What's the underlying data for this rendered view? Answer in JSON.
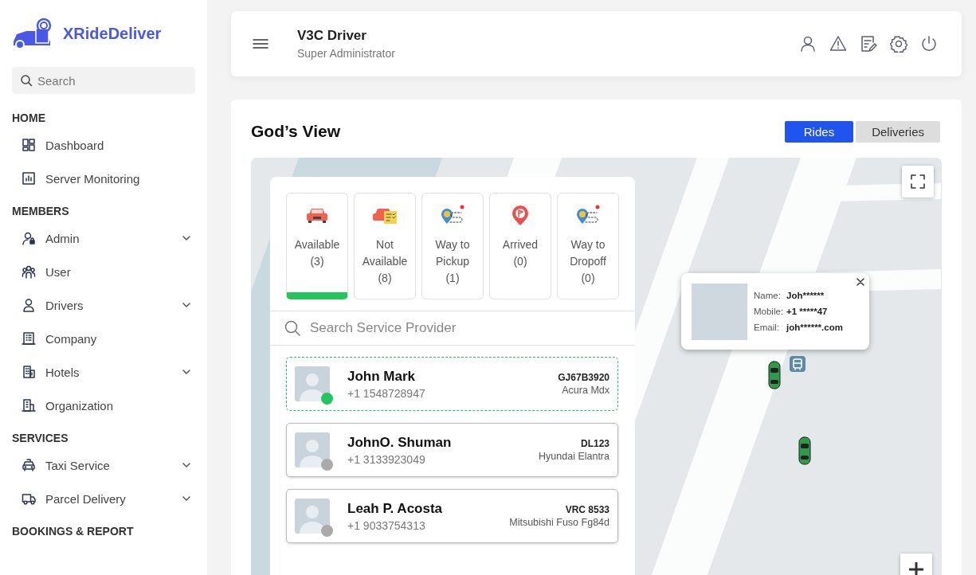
{
  "brand": {
    "name": "XRideDeliver"
  },
  "sidebar": {
    "search": {
      "placeholder": "Search"
    },
    "sections": [
      {
        "heading": "HOME",
        "items": [
          {
            "label": "Dashboard",
            "expandable": false
          },
          {
            "label": "Server Monitoring",
            "expandable": false
          }
        ]
      },
      {
        "heading": "MEMBERS",
        "items": [
          {
            "label": "Admin",
            "expandable": true
          },
          {
            "label": "User",
            "expandable": false
          },
          {
            "label": "Drivers",
            "expandable": true
          },
          {
            "label": "Company",
            "expandable": false
          },
          {
            "label": "Hotels",
            "expandable": true
          },
          {
            "label": "Organization",
            "expandable": false
          }
        ]
      },
      {
        "heading": "SERVICES",
        "items": [
          {
            "label": "Taxi Service",
            "expandable": true
          },
          {
            "label": "Parcel Delivery",
            "expandable": true
          }
        ]
      },
      {
        "heading": "BOOKINGS & REPORT"
      }
    ]
  },
  "header": {
    "title": "V3C Driver",
    "subtitle": "Super Administrator"
  },
  "page": {
    "title": "God’s View",
    "tabs": [
      {
        "label": "Rides",
        "selected": true
      },
      {
        "label": "Deliveries",
        "selected": false
      }
    ]
  },
  "status_filters": [
    {
      "label": "Available",
      "count": "(3)",
      "selected": true
    },
    {
      "label": "Not Available",
      "count": "(8)",
      "selected": false
    },
    {
      "label": "Way to Pickup",
      "count": "(1)",
      "selected": false
    },
    {
      "label": "Arrived",
      "count": "(0)",
      "selected": false
    },
    {
      "label": "Way to Dropoff",
      "count": "(0)",
      "selected": false
    }
  ],
  "provider_search": {
    "placeholder": "Search Service Provider"
  },
  "providers": [
    {
      "name": "John Mark",
      "phone": "+1 1548728947",
      "plate": "GJ67B3920",
      "vehicle": "Acura Mdx",
      "online": true,
      "selected": true
    },
    {
      "name": "JohnO. Shuman",
      "phone": "+1 3133923049",
      "plate": "DL123",
      "vehicle": "Hyundai Elantra",
      "online": false,
      "selected": false
    },
    {
      "name": "Leah P. Acosta",
      "phone": "+1 9033754313",
      "plate": "VRC 8533",
      "vehicle": "Mitsubishi Fuso Fg84d",
      "online": false,
      "selected": false
    }
  ],
  "map_popup": {
    "fields": [
      {
        "label": "Name:",
        "value": "Joh******"
      },
      {
        "label": "Mobile:",
        "value": "+1 *****47"
      },
      {
        "label": "Email:",
        "value": "joh******.com"
      }
    ]
  }
}
